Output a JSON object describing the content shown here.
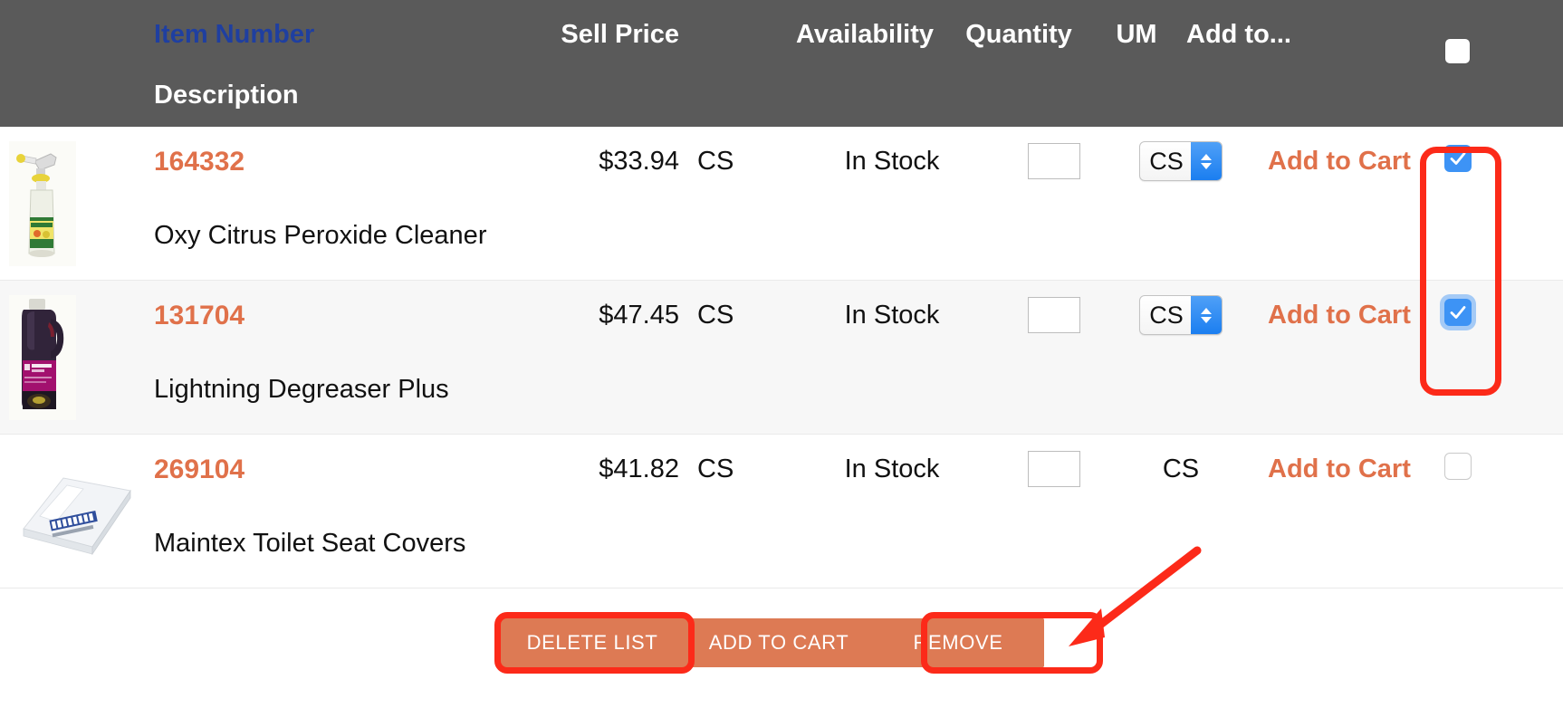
{
  "table": {
    "headers": {
      "item_number": "Item Number",
      "description": "Description",
      "sell_price": "Sell Price",
      "availability": "Availability",
      "quantity": "Quantity",
      "um": "UM",
      "add_to": "Add to..."
    },
    "rows": [
      {
        "item_number": "164332",
        "description": "Oxy Citrus Peroxide Cleaner",
        "price": "$33.94",
        "price_um": "CS",
        "availability": "In Stock",
        "quantity": "",
        "um_value": "CS",
        "um_is_select": true,
        "add_to_cart": "Add to Cart",
        "checked": true,
        "focused": false
      },
      {
        "item_number": "131704",
        "description": "Lightning Degreaser Plus",
        "price": "$47.45",
        "price_um": "CS",
        "availability": "In Stock",
        "quantity": "",
        "um_value": "CS",
        "um_is_select": true,
        "add_to_cart": "Add to Cart",
        "checked": true,
        "focused": true
      },
      {
        "item_number": "269104",
        "description": "Maintex Toilet Seat Covers",
        "price": "$41.82",
        "price_um": "CS",
        "availability": "In Stock",
        "quantity": "",
        "um_value": "CS",
        "um_is_select": false,
        "add_to_cart": "Add to Cart",
        "checked": false,
        "focused": false
      }
    ]
  },
  "buttons": {
    "delete_list": "DELETE LIST",
    "add_to_cart": "ADD TO CART",
    "remove": "REMOVE"
  },
  "colors": {
    "header_bg": "#5a5a5a",
    "header_link": "#1f3fa0",
    "accent_orange": "#e0714a",
    "button_bar": "#dd7a54",
    "annotation_red": "#fc2a19",
    "checkbox_blue": "#3d93f5",
    "alt_row": "#f7f7f7"
  }
}
